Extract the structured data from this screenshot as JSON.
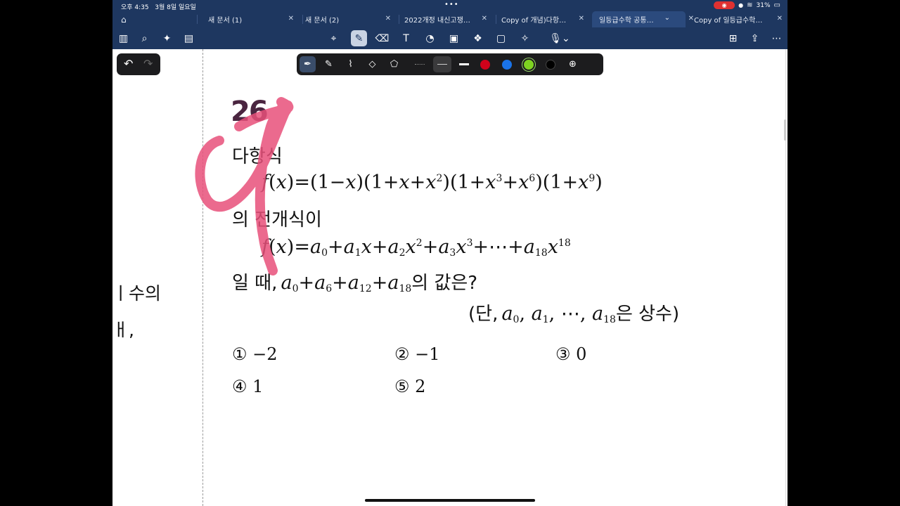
{
  "status": {
    "time": "오후 4:35",
    "date": "3월 8일 일요일",
    "battery": "31%"
  },
  "tabs": [
    {
      "label": "새 문서 (1)"
    },
    {
      "label": "새 문서 (2)"
    },
    {
      "label": "2022개정 내신고쟁…"
    },
    {
      "label": "Copy of 개념)다항…"
    },
    {
      "label": "일등급수학 공통…"
    },
    {
      "label": "Copy of 일등급수학…"
    }
  ],
  "icons": {
    "home": "house-icon",
    "sidebar": "sidebar-icon",
    "search": "search-icon",
    "ai": "sparkle-icon",
    "pages": "pages-icon",
    "lasso": "lasso-icon",
    "pen": "pen-icon",
    "eraser": "eraser-icon",
    "textbox": "textbox-icon",
    "shapes": "shapes-icon",
    "image": "image-icon",
    "elements": "elements-icon",
    "sticky": "sticky-note-icon",
    "laser": "laser-pointer-icon",
    "mic": "microphone-icon",
    "addpage": "add-page-icon",
    "share": "share-icon",
    "more": "more-icon"
  },
  "colors": {
    "accent": "#1e3760",
    "red": "#d0021b",
    "blue": "#1a73e8",
    "green": "#7ed321",
    "black": "#000000",
    "annotation": "#e8507a"
  },
  "question": {
    "number": "26",
    "intro": "다항식",
    "expansion_label": "의 전개식이",
    "ask_prefix": "일 때,",
    "ask_suffix": "의 값은?",
    "cond_open": "(단,",
    "cond_suffix": "은 상수)",
    "choices": [
      "① −2",
      "② −1",
      "③ 0",
      "④ 1",
      "⑤ 2"
    ]
  },
  "left_fragments": [
    "ㅣ수의",
    "ㅐ,"
  ]
}
